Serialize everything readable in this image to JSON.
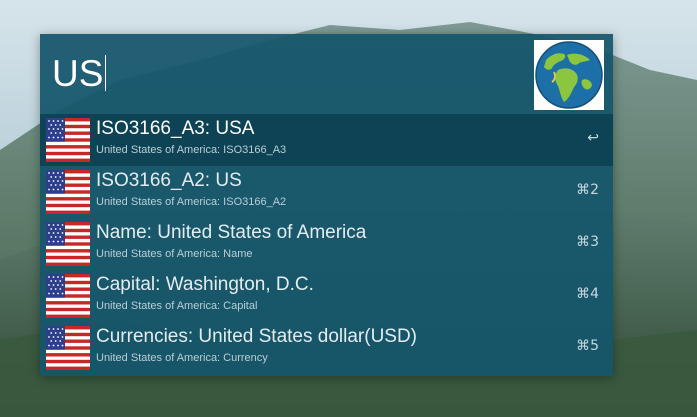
{
  "search": {
    "query": "US"
  },
  "header_icon": "globe-icon",
  "results": [
    {
      "title": "ISO3166_A3: USA",
      "subtitle": "United States of America: ISO3166_A3",
      "shortcut": "↩",
      "icon": "us-flag-icon"
    },
    {
      "title": "ISO3166_A2: US",
      "subtitle": "United States of America: ISO3166_A2",
      "shortcut": "⌘2",
      "icon": "us-flag-icon"
    },
    {
      "title": "Name: United States of America",
      "subtitle": "United States of America: Name",
      "shortcut": "⌘3",
      "icon": "us-flag-icon"
    },
    {
      "title": "Capital: Washington, D.C.",
      "subtitle": "United States of America: Capital",
      "shortcut": "⌘4",
      "icon": "us-flag-icon"
    },
    {
      "title": "Currencies: United States dollar(USD)",
      "subtitle": "United States of America: Currency",
      "shortcut": "⌘5",
      "icon": "us-flag-icon"
    }
  ],
  "colors": {
    "panel": "#14556c",
    "selected_row": "#0a3c4e",
    "text": "#ffffff",
    "subtext": "#b9cfd7"
  }
}
